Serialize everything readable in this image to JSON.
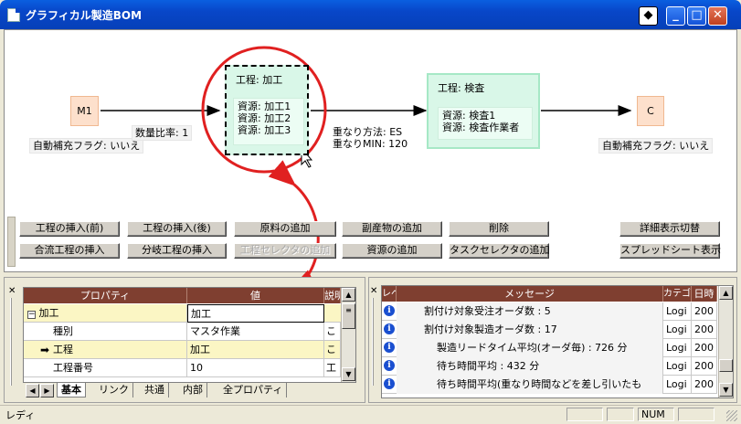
{
  "window": {
    "title": "グラフィカル製造BOM"
  },
  "canvas": {
    "node_m1": {
      "label": "M1"
    },
    "node_kakou": {
      "title": "工程: 加工",
      "resources": [
        "資源: 加工1",
        "資源: 加工2",
        "資源: 加工3"
      ]
    },
    "node_kensa": {
      "title": "工程: 検査",
      "resources": [
        "資源: 検査1",
        "資源: 検査作業者"
      ]
    },
    "node_c": {
      "label": "C"
    },
    "ratio_label": "数量比率: 1",
    "auto_flag_left": "自動補充フラグ: いいえ",
    "auto_flag_right": "自動補充フラグ: いいえ",
    "overlap_method": "重なり方法: ES",
    "overlap_min": "重なりMIN: 120"
  },
  "toolbar": {
    "row1": [
      "工程の挿入(前)",
      "工程の挿入(後)",
      "原料の追加",
      "副産物の追加",
      "削除"
    ],
    "row2": [
      "合流工程の挿入",
      "分岐工程の挿入",
      "工程セレクタの追加",
      "資源の追加",
      "タスクセレクタの追加"
    ],
    "detail_toggle": "詳細表示切替",
    "spreadsheet": "スプレッドシート表示"
  },
  "property_pane": {
    "headers": [
      "プロパティ",
      "値",
      "説明"
    ],
    "rows": [
      {
        "prop": "加工",
        "value": "加工",
        "desc": ""
      },
      {
        "prop": "種別",
        "value": "マスタ作業",
        "desc": "こ"
      },
      {
        "prop": "工程",
        "value": "加工",
        "desc": "こ"
      },
      {
        "prop": "工程番号",
        "value": "10",
        "desc": "工"
      }
    ],
    "tabs": [
      "基本",
      "リンク",
      "共通",
      "内部",
      "全プロパティ"
    ]
  },
  "message_pane": {
    "headers": [
      "レベル",
      "メッセージ",
      "カテゴリ",
      "日時"
    ],
    "rows": [
      {
        "message": "割付け対象受注オーダ数 : 5",
        "category": "Logi",
        "date": "200"
      },
      {
        "message": "割付け対象製造オーダ数 : 17",
        "category": "Logi",
        "date": "200"
      },
      {
        "message": "製造リードタイム平均(オーダ毎) : 726 分",
        "category": "Logi",
        "date": "200"
      },
      {
        "message": "待ち時間平均 : 432 分",
        "category": "Logi",
        "date": "200"
      },
      {
        "message": "待ち時間平均(重なり時間などを差し引いたも",
        "category": "Logi",
        "date": "200"
      }
    ]
  },
  "statusbar": {
    "text": "レディ",
    "num": "NUM"
  },
  "colors": {
    "accent_red": "#e02020",
    "node_green": "#d9f7e8",
    "node_orange": "#fde0cc",
    "header_brown": "#7f3f30"
  }
}
